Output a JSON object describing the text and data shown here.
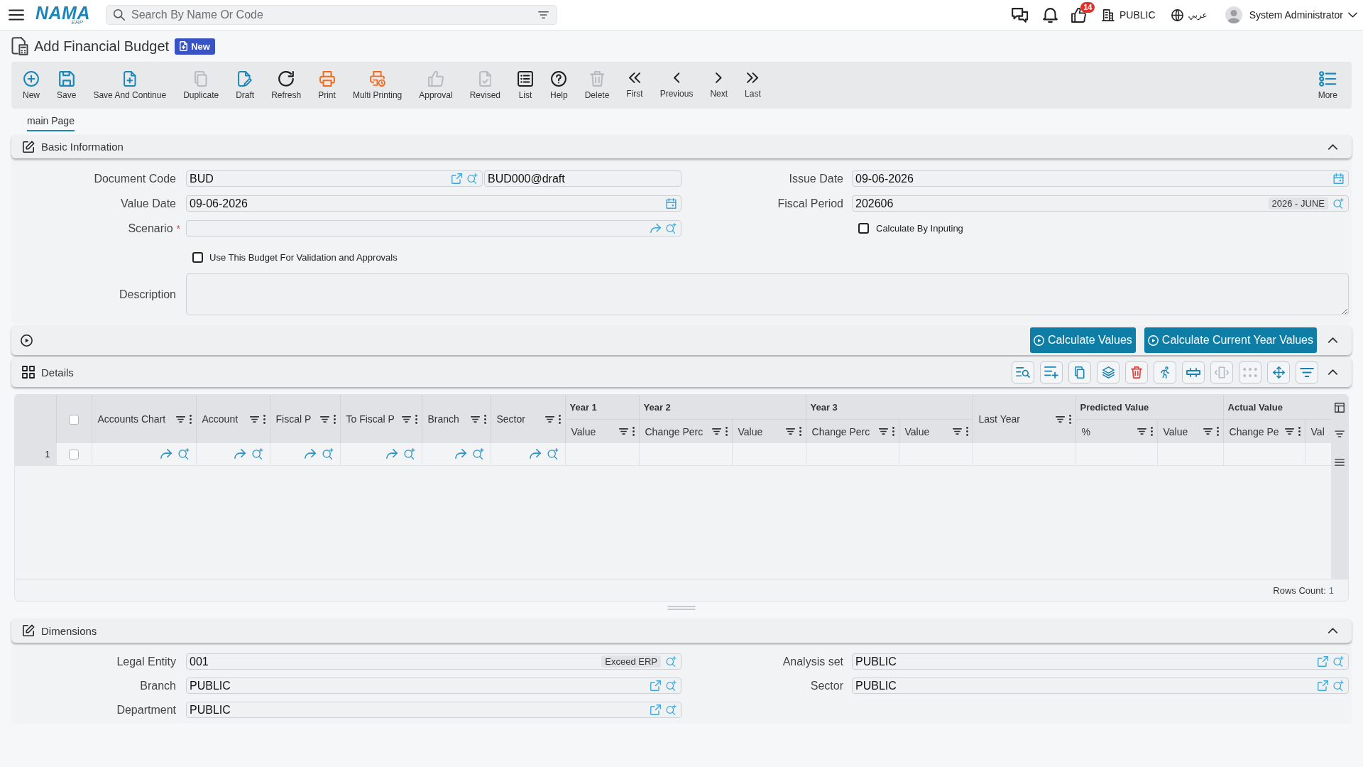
{
  "top_bar": {
    "logo": {
      "name": "NAMA",
      "suffix": "ERP"
    },
    "search": {
      "placeholder": "Search By Name Or Code"
    },
    "notification_count": "14",
    "company": "PUBLIC",
    "language": "عربي",
    "user": "System Administrator"
  },
  "page": {
    "title": "Add Financial Budget",
    "status": "New"
  },
  "toolbar": [
    {
      "label": "New",
      "disabled": false
    },
    {
      "label": "Save",
      "disabled": false
    },
    {
      "label": "Save And Continue",
      "disabled": false
    },
    {
      "label": "Duplicate",
      "disabled": true
    },
    {
      "label": "Draft",
      "disabled": false
    },
    {
      "label": "Refresh",
      "disabled": false
    },
    {
      "label": "Print",
      "disabled": false
    },
    {
      "label": "Multi Printing",
      "disabled": false
    },
    {
      "label": "Approval",
      "disabled": true
    },
    {
      "label": "Revised",
      "disabled": true
    },
    {
      "label": "List",
      "disabled": false
    },
    {
      "label": "Help",
      "disabled": false
    },
    {
      "label": "Delete",
      "disabled": true
    },
    {
      "label": "First",
      "disabled": false
    },
    {
      "label": "Previous",
      "disabled": false
    },
    {
      "label": "Next",
      "disabled": false
    },
    {
      "label": "Last",
      "disabled": false
    },
    {
      "label": "More",
      "disabled": false
    }
  ],
  "tabs": [
    {
      "label": "main Page",
      "selected": true
    }
  ],
  "basic_information": {
    "title": "Basic Information",
    "document_code": {
      "label": "Document Code",
      "value": "BUD",
      "code": "BUD000@draft"
    },
    "issue_date": {
      "label": "Issue Date",
      "value": "09-06-2026"
    },
    "value_date": {
      "label": "Value Date",
      "value": "09-06-2026"
    },
    "fiscal_period": {
      "label": "Fiscal Period",
      "value": "202606",
      "tag": "2026 - JUNE"
    },
    "scenario": {
      "label": "Scenario",
      "required_mark": "*"
    },
    "calculate_by_inputing": {
      "label": "Calculate By Inputing",
      "checked": false
    },
    "use_for_validation": {
      "label": "Use This Budget For Validation and Approvals",
      "checked": false
    },
    "description": {
      "label": "Description"
    }
  },
  "calculation": {
    "buttons": [
      "Calculate Values",
      "Calculate Current Year Values"
    ]
  },
  "details": {
    "title": "Details",
    "tools": [
      {
        "disabled": false
      },
      {
        "disabled": false
      },
      {
        "disabled": false
      },
      {
        "disabled": false
      },
      {
        "disabled": false
      },
      {
        "disabled": false
      },
      {
        "disabled": false
      },
      {
        "disabled": true
      },
      {
        "disabled": true
      },
      {
        "disabled": false
      },
      {
        "disabled": false
      }
    ],
    "grid": {
      "select_all": false,
      "columns": [
        {
          "kind": "lookup",
          "label": "Accounts Chart"
        },
        {
          "kind": "lookup",
          "label": "Account"
        },
        {
          "kind": "lookup",
          "label": "Fiscal P"
        },
        {
          "kind": "lookup",
          "label": "To Fiscal P"
        },
        {
          "kind": "lookup",
          "label": "Branch"
        },
        {
          "kind": "lookup",
          "label": "Sector"
        },
        {
          "kind": "group",
          "group": "Year 1",
          "children": [
            {
              "label": "Value"
            }
          ]
        },
        {
          "kind": "group",
          "group": "Year 2",
          "children": [
            {
              "label": "Change Perc"
            },
            {
              "label": "Value"
            }
          ]
        },
        {
          "kind": "group",
          "group": "Year 3",
          "children": [
            {
              "label": "Change Perc"
            },
            {
              "label": "Value"
            }
          ]
        },
        {
          "kind": "number",
          "label": "Last Year"
        },
        {
          "kind": "group",
          "group": "Predicted Value",
          "children": [
            {
              "label": "%"
            },
            {
              "label": "Value"
            }
          ]
        },
        {
          "kind": "group",
          "group": "Actual Value",
          "children": [
            {
              "label": "Change Pe"
            },
            {
              "label": "Val"
            }
          ]
        }
      ],
      "rows": [
        {
          "number": "1",
          "checked": false
        }
      ],
      "rows_count": {
        "label": "Rows Count:",
        "value": "1"
      }
    }
  },
  "dimensions": {
    "title": "Dimensions",
    "fields": [
      {
        "label": "Legal Entity",
        "value": "001",
        "tag": "Exceed ERP"
      },
      {
        "label": "Analysis set",
        "value": "PUBLIC"
      },
      {
        "label": "Branch",
        "value": "PUBLIC"
      },
      {
        "label": "Sector",
        "value": "PUBLIC"
      },
      {
        "label": "Department",
        "value": "PUBLIC"
      }
    ]
  }
}
